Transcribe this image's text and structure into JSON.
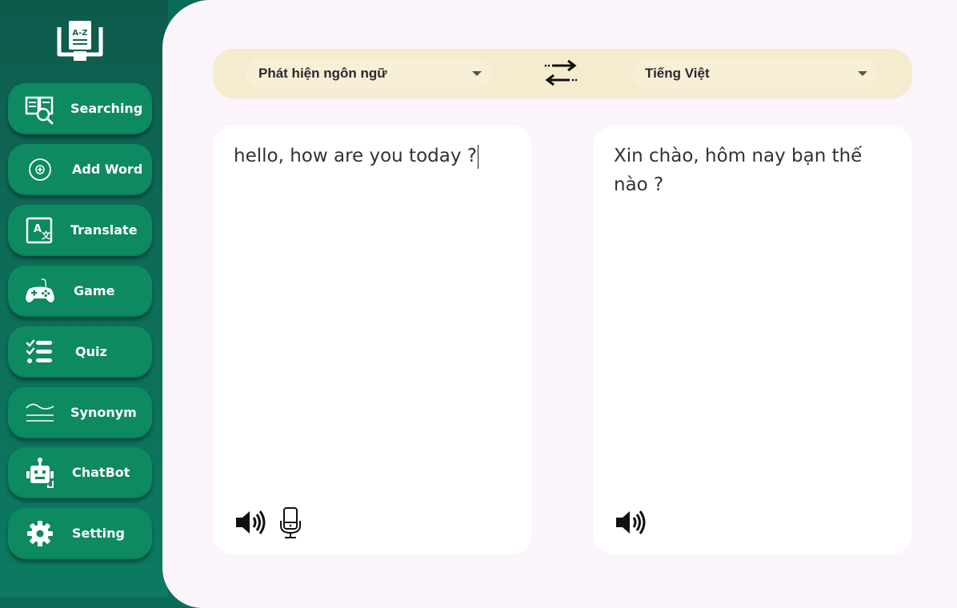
{
  "sidebar": {
    "logo": {
      "text": "A-Z",
      "icon": "dictionary-book-icon"
    },
    "items": [
      {
        "label": "Searching",
        "icon": "book-search-icon"
      },
      {
        "label": "Add Word",
        "icon": "add-circle-icon"
      },
      {
        "label": "Translate",
        "icon": "translate-icon"
      },
      {
        "label": "Game",
        "icon": "gamepad-icon"
      },
      {
        "label": "Quiz",
        "icon": "checklist-icon"
      },
      {
        "label": "Synonym",
        "icon": "waves-icon"
      },
      {
        "label": "ChatBot",
        "icon": "robot-icon"
      },
      {
        "label": "Setting",
        "icon": "gear-icon"
      }
    ]
  },
  "translator": {
    "source_language": "Phát hiện ngôn ngữ",
    "target_language": "Tiếng Việt",
    "source_text": "hello, how are you today ?",
    "target_text": "Xin chào, hôm nay bạn thế nào ?"
  },
  "colors": {
    "sidebar": "#0d6b57",
    "button": "#0d8a62",
    "language_bar": "#f5eccf",
    "main_bg": "#fbf4fb"
  }
}
